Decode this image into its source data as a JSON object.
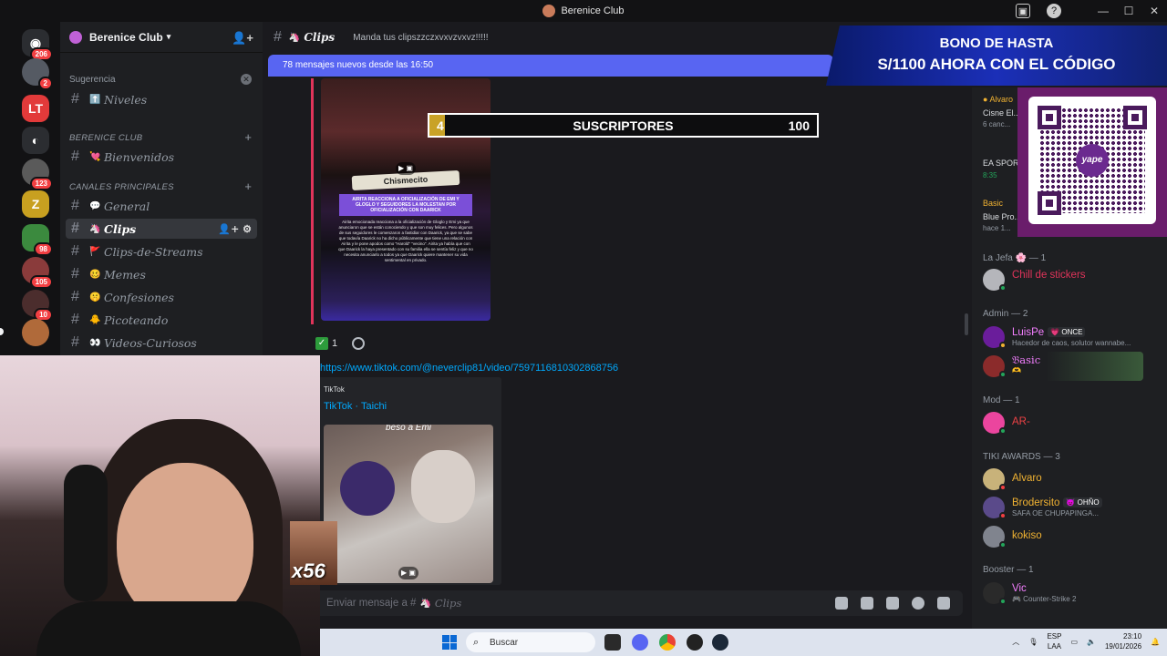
{
  "window": {
    "title": "Berenice Club"
  },
  "rail": {
    "servers": [
      {
        "name": "Discord home",
        "badge": "206"
      },
      {
        "name": "Server avatar 1",
        "badge": "2"
      },
      {
        "name": "Server LT",
        "badge": ""
      },
      {
        "name": "Discord",
        "badge": ""
      },
      {
        "name": "Server 4",
        "badge": "123"
      },
      {
        "name": "Server Z",
        "badge": ""
      },
      {
        "name": "Server 6",
        "badge": "98"
      },
      {
        "name": "Server 7",
        "badge": "105"
      },
      {
        "name": "Server 8",
        "badge": "10"
      },
      {
        "name": "Server 9",
        "badge": ""
      }
    ]
  },
  "sidebar": {
    "server_name": "Berenice Club",
    "suggestion_label": "Sugerencia",
    "suggested_channel": "Niveles",
    "categories": [
      {
        "label": "BERENICE CLUB"
      },
      {
        "label": "CANALES PRINCIPALES"
      }
    ],
    "channels": [
      {
        "name": "Bienvenidos",
        "emoji": "💘"
      },
      {
        "name": "General",
        "emoji": "💬"
      },
      {
        "name": "Clips",
        "emoji": "🦄"
      },
      {
        "name": "Clips-de-Streams",
        "emoji": "🚩"
      },
      {
        "name": "Memes",
        "emoji": "🥴"
      },
      {
        "name": "Confesiones",
        "emoji": "🤫"
      },
      {
        "name": "Picoteando",
        "emoji": "🐥"
      },
      {
        "name": "Videos-Curiosos",
        "emoji": "👀"
      }
    ]
  },
  "channel_header": {
    "name": "Clips",
    "topic": "Manda tus clipszzczxvxvzvxvz!!!!!"
  },
  "new_messages_banner": "78 mensajes nuevos desde las 16:50",
  "message": {
    "image_card": {
      "title": "Chismecito",
      "headline": "AIRITA REACCIONA A OFICIALIZACIÓN DE EMI Y GLOGLO Y SEGUIDORES LA MOLESTAN POR OFICIALIZACIÓN CON DAARICK",
      "body": "Airita emocionada reacciona a la oficialización de Gloglo y Emi ya que anunciaron que se están conociendo y que son muy felices. Pero algunos de sus seguidores le comenzaron a fastidiar con Daarick, ya que se sabe que todavía Daarick no ha dicho públicamente que tiene una relación con Airita y le pone apodos como \"Harold\" \"vecino\". Airita ya había que con que Daarick la haya presentado con su familia ella se sentía feliz y que no necesita anunciarlo a todos ya que Daarick quiere mantener su vida sentimental en privado."
    },
    "reactions": [
      {
        "emoji": "✅",
        "count": "1"
      }
    ],
    "link": "https://www.tiktok.com/@neverclip81/video/7597116810302868756",
    "embed": {
      "provider": "TikTok",
      "title": "TikTok · Taichi",
      "thumbnail_caption": "beso a Emi"
    }
  },
  "composer": {
    "placeholder_prefix": "Enviar mensaje a #",
    "channel": "Clips"
  },
  "overlays": {
    "subs": {
      "current": "4",
      "label": "SUSCRIPTORES",
      "goal": "100",
      "progress": 0.04
    },
    "promo": {
      "line1": "BONO DE HASTA",
      "line2": "S/1100 AHORA CON EL CÓDIGO"
    },
    "qr_brand": "yape",
    "emote_counter": "x56"
  },
  "members": {
    "partial": [
      {
        "name": "Alvaro",
        "sub": "Cisne El...",
        "sub2": "6 canc..."
      },
      {
        "name": "EA SPOR...",
        "sub": "8:35"
      },
      {
        "name": "Basic",
        "sub": "Blue Pro...",
        "sub2": "hace 1..."
      }
    ],
    "groups": [
      {
        "label": "La Jefa 🌸 — 1",
        "members": [
          {
            "name": "Chill de stickers",
            "color": "#e0345a",
            "sub": "",
            "tag": ""
          }
        ]
      },
      {
        "label": "Admin — 2",
        "members": [
          {
            "name": "LuisPe",
            "color": "#f47fff",
            "sub": "Hacedor de caos, solutor wannabe...",
            "tag": "💗 ONCE"
          },
          {
            "name": "𝔅asic",
            "color": "#f47fff",
            "sub": "🫶",
            "tag": ""
          }
        ]
      },
      {
        "label": "Mod — 1",
        "members": [
          {
            "name": "AR-",
            "color": "#ed4245",
            "sub": "",
            "tag": ""
          }
        ]
      },
      {
        "label": "TIKI AWARDS — 3",
        "members": [
          {
            "name": "Alvaro",
            "color": "#f0b232",
            "sub": "",
            "tag": ""
          },
          {
            "name": "Brodersito",
            "color": "#f0b232",
            "sub": "SAFA OE CHUPAPINGA...",
            "tag": "😈 OHÑO"
          },
          {
            "name": "kokiso",
            "color": "#f0b232",
            "sub": "",
            "tag": ""
          }
        ]
      },
      {
        "label": "Booster — 1",
        "members": [
          {
            "name": "Vic",
            "color": "#f47fff",
            "sub": "🎮 Counter-Strike 2",
            "tag": ""
          }
        ]
      }
    ]
  },
  "taskbar": {
    "search_placeholder": "Buscar",
    "lang": "ESP",
    "lang2": "LAA",
    "time": "23:10",
    "date": "19/01/2026"
  }
}
